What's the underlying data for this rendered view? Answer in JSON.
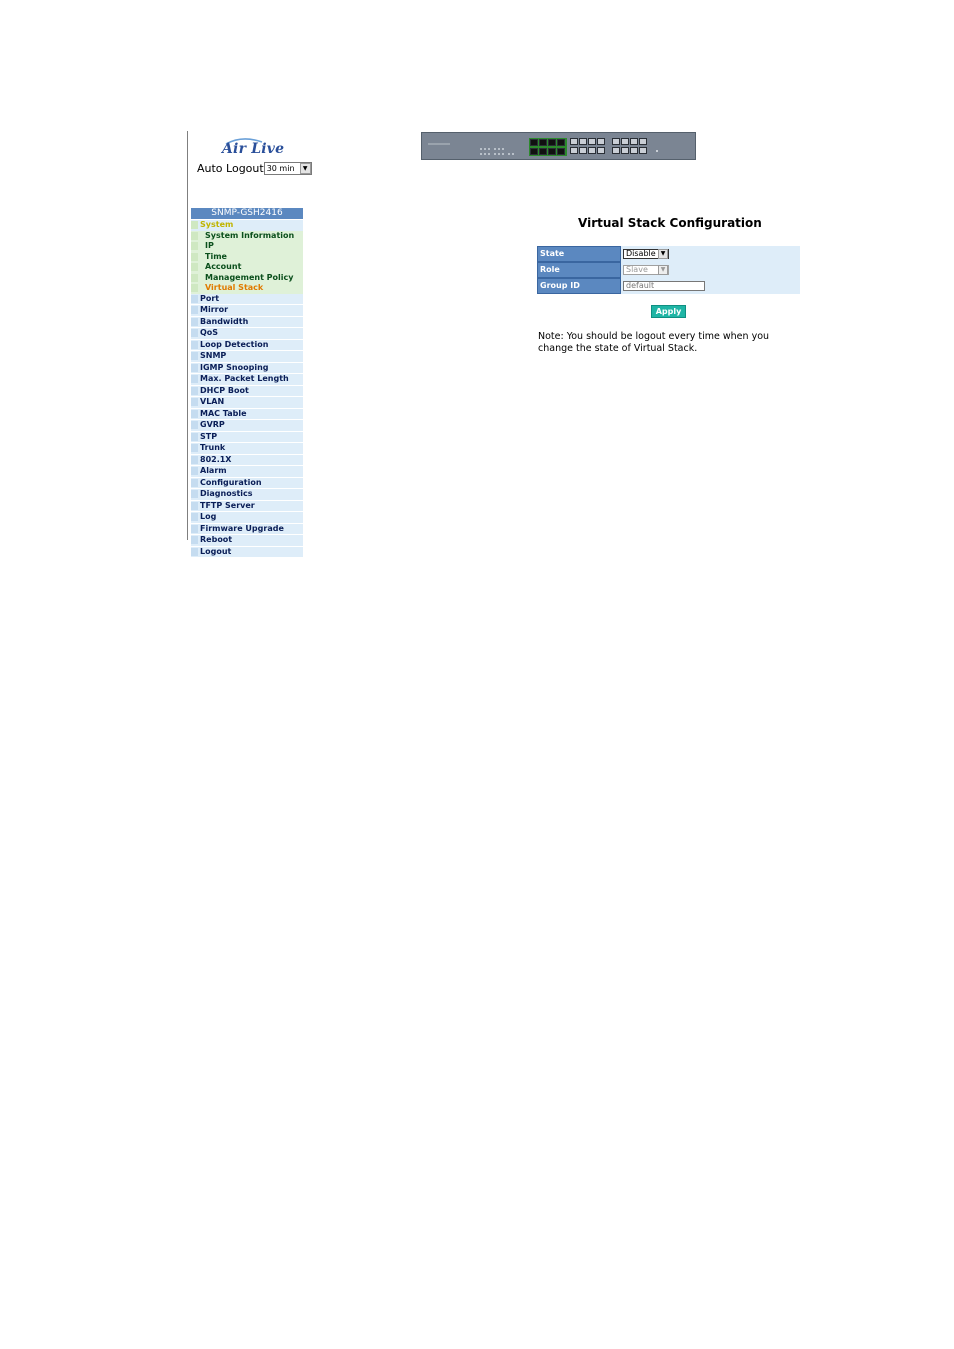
{
  "logo": {
    "text": "Air Live"
  },
  "auto_logout": {
    "label": "Auto Logout",
    "selected": "30 min"
  },
  "sidebar": {
    "header": "SNMP-GSH2416",
    "items": [
      {
        "label": "System",
        "kind": "sys"
      },
      {
        "label": "System Information",
        "kind": "sub"
      },
      {
        "label": "IP",
        "kind": "sub"
      },
      {
        "label": "Time",
        "kind": "sub"
      },
      {
        "label": "Account",
        "kind": "sub"
      },
      {
        "label": "Management Policy",
        "kind": "sub"
      },
      {
        "label": "Virtual Stack",
        "kind": "sub-active"
      },
      {
        "label": "Port",
        "kind": "top"
      },
      {
        "label": "Mirror",
        "kind": "top"
      },
      {
        "label": "Bandwidth",
        "kind": "top"
      },
      {
        "label": "QoS",
        "kind": "top"
      },
      {
        "label": "Loop Detection",
        "kind": "top"
      },
      {
        "label": "SNMP",
        "kind": "top"
      },
      {
        "label": "IGMP Snooping",
        "kind": "top"
      },
      {
        "label": "Max. Packet Length",
        "kind": "top"
      },
      {
        "label": "DHCP Boot",
        "kind": "top"
      },
      {
        "label": "VLAN",
        "kind": "top"
      },
      {
        "label": "MAC Table",
        "kind": "top"
      },
      {
        "label": "GVRP",
        "kind": "top"
      },
      {
        "label": "STP",
        "kind": "top"
      },
      {
        "label": "Trunk",
        "kind": "top"
      },
      {
        "label": "802.1X",
        "kind": "top"
      },
      {
        "label": "Alarm",
        "kind": "top"
      },
      {
        "label": "Configuration",
        "kind": "top"
      },
      {
        "label": "Diagnostics",
        "kind": "top"
      },
      {
        "label": "TFTP Server",
        "kind": "top"
      },
      {
        "label": "Log",
        "kind": "top"
      },
      {
        "label": "Firmware Upgrade",
        "kind": "top"
      },
      {
        "label": "Reboot",
        "kind": "top"
      },
      {
        "label": "Logout",
        "kind": "top"
      }
    ]
  },
  "main": {
    "title": "Virtual Stack Configuration",
    "fields": {
      "state": {
        "label": "State",
        "value": "Disable"
      },
      "role": {
        "label": "Role",
        "value": "Slave"
      },
      "group_id": {
        "label": "Group ID",
        "value": "default"
      }
    },
    "apply_label": "Apply",
    "note": "Note: You should be logout every time when you change the state of Virtual Stack."
  },
  "colors": {
    "menu_header": "#5b88c0",
    "active_item": "#e07a00",
    "apply_button": "#1fb5a5"
  }
}
